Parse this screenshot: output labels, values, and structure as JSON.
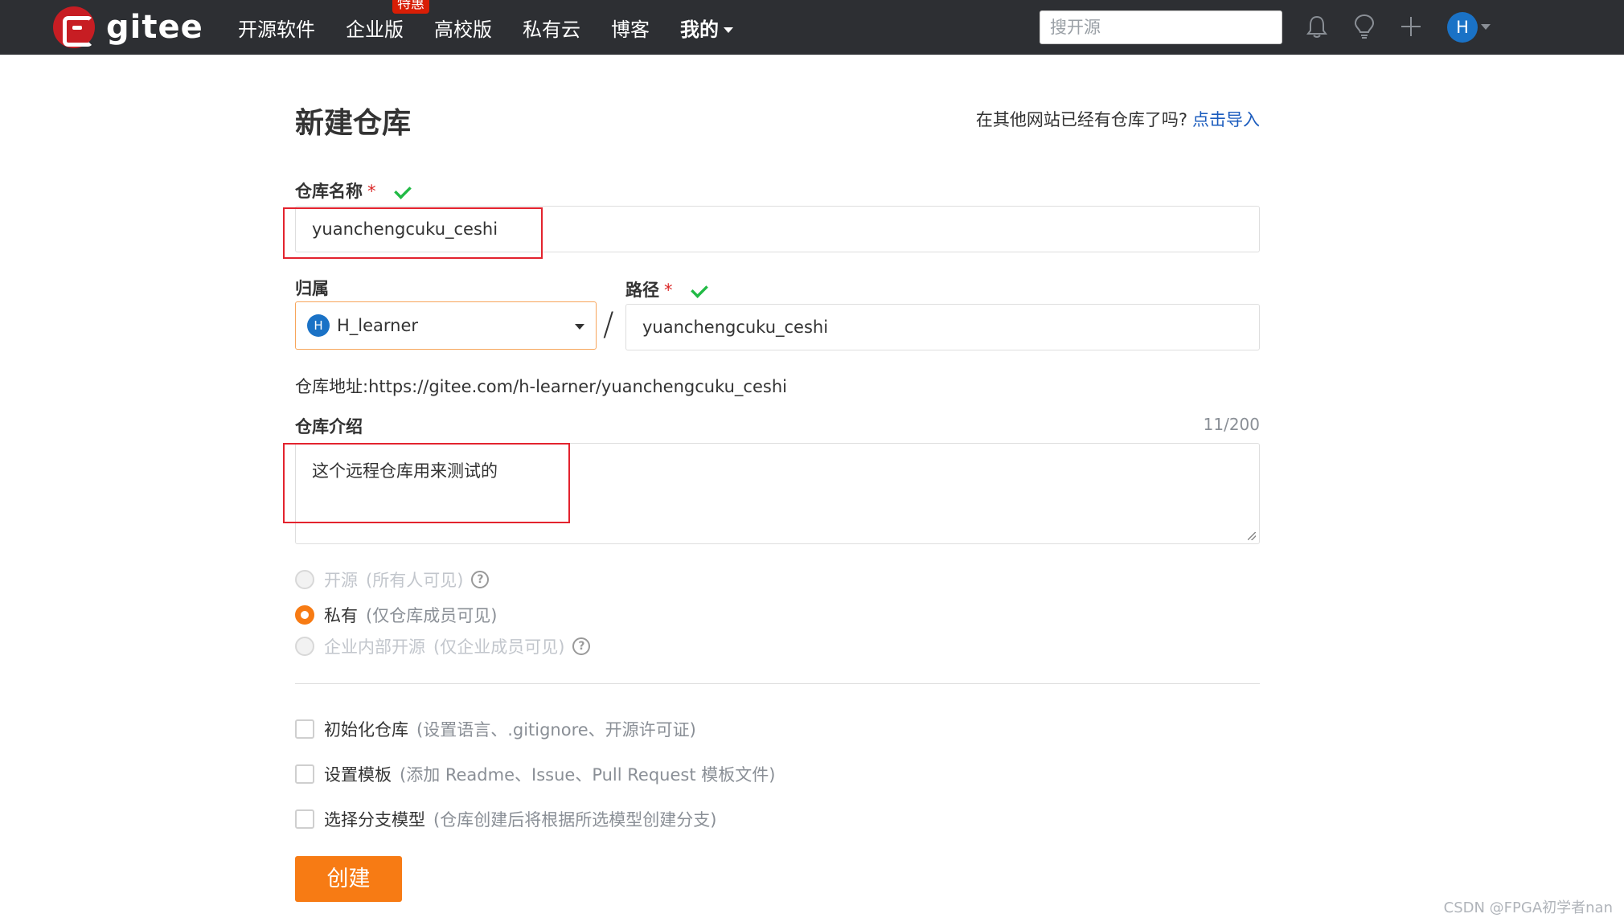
{
  "brand": {
    "name": "gitee"
  },
  "nav": {
    "items": [
      {
        "label": "开源软件"
      },
      {
        "label": "企业版",
        "badge": "特惠"
      },
      {
        "label": "高校版"
      },
      {
        "label": "私有云"
      },
      {
        "label": "博客"
      },
      {
        "label": "我的"
      }
    ],
    "search_placeholder": "搜开源",
    "avatar_initial": "H"
  },
  "page": {
    "title": "新建仓库",
    "import_hint": "在其他网站已经有仓库了吗?",
    "import_link": "点击导入"
  },
  "form": {
    "repo_name": {
      "label": "仓库名称",
      "required_mark": "*",
      "value": "yuanchengcuku_ceshi"
    },
    "owner": {
      "label": "归属",
      "avatar_initial": "H",
      "value": "H_learner"
    },
    "path_separator": "/",
    "path": {
      "label": "路径",
      "required_mark": "*",
      "value": "yuanchengcuku_ceshi"
    },
    "repo_url": {
      "label": "仓库地址:",
      "value": "https://gitee.com/h-learner/yuanchengcuku_ceshi"
    },
    "description": {
      "label": "仓库介绍",
      "counter": "11/200",
      "value": "这个远程仓库用来测试的"
    },
    "visibility": [
      {
        "label": "开源",
        "desc": "(所有人可见)",
        "state": "disabled",
        "help": "?"
      },
      {
        "label": "私有",
        "desc": "(仅仓库成员可见)",
        "state": "checked"
      },
      {
        "label": "企业内部开源",
        "desc": "(仅企业成员可见)",
        "state": "disabled",
        "help": "?"
      }
    ],
    "options": [
      {
        "label": "初始化仓库",
        "desc": "(设置语言、.gitignore、开源许可证)",
        "checked": false
      },
      {
        "label": "设置模板",
        "desc": "(添加 Readme、Issue、Pull Request 模板文件)",
        "checked": false
      },
      {
        "label": "选择分支模型",
        "desc": "(仓库创建后将根据所选模型创建分支)",
        "checked": false
      }
    ],
    "submit_label": "创建"
  },
  "watermark": "CSDN @FPGA初学者nan",
  "colors": {
    "accent": "#f77b14",
    "topbar": "#2d2f33",
    "brand_red": "#c71d23",
    "link": "#1a5bbd",
    "highlight": "#e3232e"
  }
}
